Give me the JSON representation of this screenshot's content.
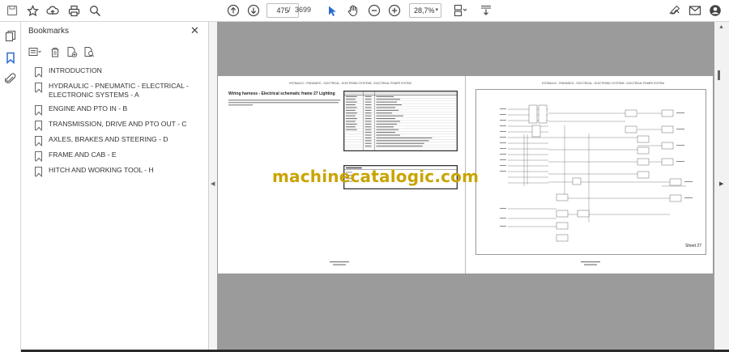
{
  "toolbar": {
    "current_page": "475",
    "page_separator": "/",
    "total_pages": "3699",
    "zoom": "28,7%"
  },
  "panel": {
    "title": "Bookmarks",
    "bookmarks": [
      "INTRODUCTION",
      "HYDRAULIC - PNEUMATIC - ELECTRICAL - ELECTRONIC SYSTEMS - A",
      "ENGINE AND PTO IN - B",
      "TRANSMISSION, DRIVE AND PTO OUT - C",
      "AXLES, BRAKES AND STEERING - D",
      "FRAME AND CAB - E",
      "HITCH AND WORKING TOOL - H"
    ]
  },
  "document": {
    "left_header": "HYDRAULIC - PNEUMATIC - ELECTRICAL - ELECTRONIC SYSTEMS - ELECTRICAL POWER SYSTEM",
    "right_header": "HYDRAULIC - PNEUMATIC - ELECTRICAL - ELECTRONIC SYSTEMS - ELECTRICAL POWER SYSTEM",
    "left_title": "Wiring harness - Electrical schematic frame 27 Lighting",
    "sheet_label": "Sheet 27",
    "watermark": "machinecatalogic.com"
  }
}
